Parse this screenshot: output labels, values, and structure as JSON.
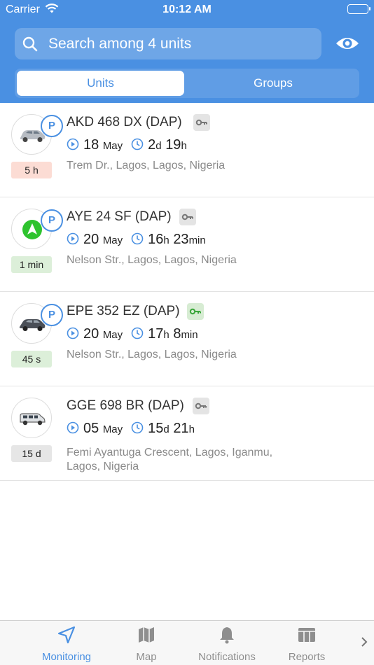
{
  "status_bar": {
    "carrier": "Carrier",
    "time": "10:12 AM"
  },
  "header": {
    "search_placeholder": "Search among 4 units",
    "tabs": [
      {
        "label": "Units",
        "active": true
      },
      {
        "label": "Groups",
        "active": false
      }
    ]
  },
  "units": [
    {
      "name": "AKD 468 DX (DAP)",
      "status_icon": "parking-icon",
      "vehicle_icon": "sedan-silver-icon",
      "badge": "5 h",
      "badge_color": "#fcdcd4",
      "key_active": false,
      "date_num": "18",
      "date_month": "May",
      "duration": [
        {
          "n": "2",
          "u": "d"
        },
        {
          "n": "19",
          "u": "h"
        }
      ],
      "address": "Trem Dr., Lagos, Lagos, Nigeria"
    },
    {
      "name": "AYE 24 SF (DAP)",
      "status_icon": "parking-icon",
      "vehicle_icon": "moving-arrow-icon",
      "badge": "1 min",
      "badge_color": "#dcefd9",
      "key_active": false,
      "date_num": "20",
      "date_month": "May",
      "duration": [
        {
          "n": "16",
          "u": "h"
        },
        {
          "n": "23",
          "u": "min"
        }
      ],
      "address": "Nelson Str., Lagos, Lagos, Nigeria"
    },
    {
      "name": "EPE 352 EZ (DAP)",
      "status_icon": "parking-icon",
      "vehicle_icon": "sedan-dark-icon",
      "badge": "45 s",
      "badge_color": "#dcefd9",
      "key_active": true,
      "date_num": "20",
      "date_month": "May",
      "duration": [
        {
          "n": "17",
          "u": "h"
        },
        {
          "n": "8",
          "u": "min"
        }
      ],
      "address": "Nelson Str., Lagos, Lagos, Nigeria"
    },
    {
      "name": "GGE 698 BR (DAP)",
      "status_icon": null,
      "vehicle_icon": "van-icon",
      "badge": "15 d",
      "badge_color": "#e6e6e6",
      "key_active": false,
      "date_num": "05",
      "date_month": "May",
      "duration": [
        {
          "n": "15",
          "u": "d"
        },
        {
          "n": "21",
          "u": "h"
        }
      ],
      "address_lines": [
        "Femi Ayantuga Crescent, Lagos, Iganmu,",
        "Lagos, Nigeria"
      ]
    }
  ],
  "tabbar": {
    "items": [
      {
        "label": "Monitoring",
        "icon": "navigation-arrow-icon",
        "active": true
      },
      {
        "label": "Map",
        "icon": "map-icon",
        "active": false
      },
      {
        "label": "Notifications",
        "icon": "bell-icon",
        "active": false
      },
      {
        "label": "Reports",
        "icon": "reports-table-icon",
        "active": false
      }
    ]
  },
  "colors": {
    "accent": "#4a90e2",
    "key_gray": "#e4e4e4",
    "key_green": "#d7ecd3"
  }
}
